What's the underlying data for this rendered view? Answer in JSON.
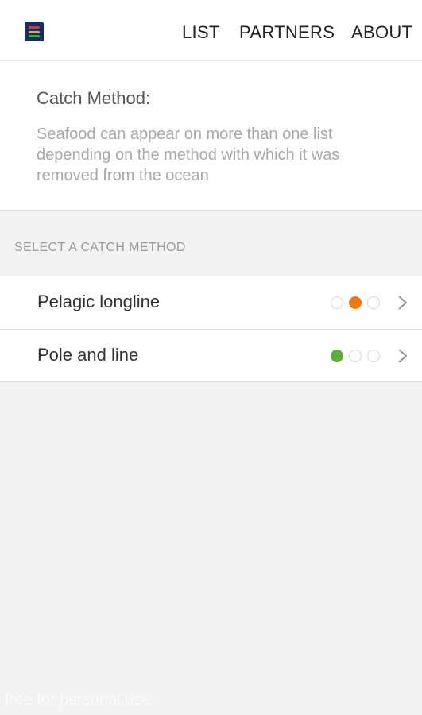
{
  "nav": {
    "list_label": "LIST",
    "partners_label": "PARTNERS",
    "about_label": "ABOUT"
  },
  "info": {
    "title": "Catch Method:",
    "description": "Seafood can appear on more than one list depending on the method with which it was removed from the ocean"
  },
  "section": {
    "header": "SELECT A CATCH METHOD"
  },
  "methods": [
    {
      "label": "Pelagic longline",
      "rating_dots": [
        "empty",
        "orange",
        "empty"
      ]
    },
    {
      "label": "Pole and line",
      "rating_dots": [
        "green",
        "empty",
        "empty"
      ]
    }
  ],
  "colors": {
    "green": "#5cae3a",
    "orange": "#ee7a0f",
    "empty": "#ffffff",
    "logo_bg": "#1b2a63",
    "logo_bars": [
      "#e5332a",
      "#f5a623",
      "#3aa648"
    ]
  },
  "watermark": "free for personal use"
}
